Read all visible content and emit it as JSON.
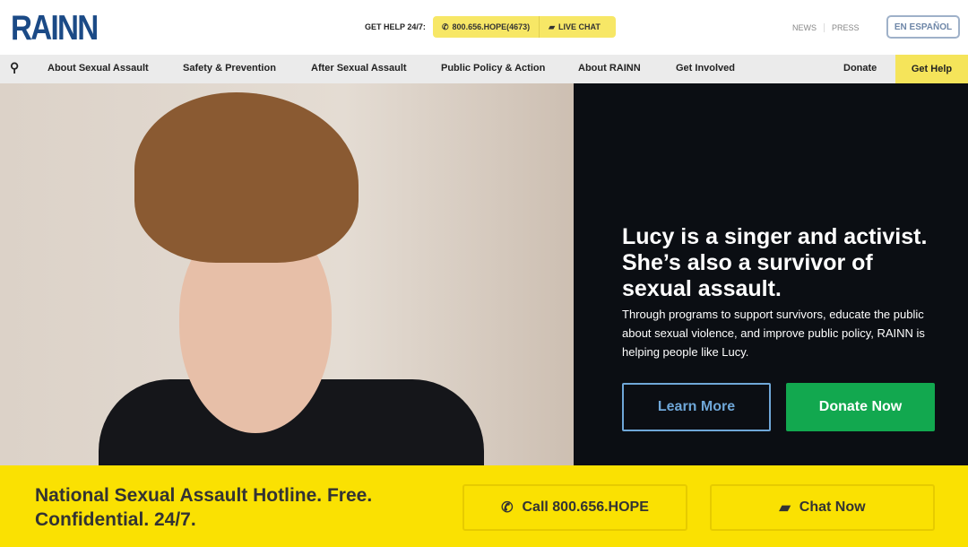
{
  "header": {
    "logo": "RAINN",
    "get_help": "GET HELP 24/7:",
    "phone": "800.656.HOPE(4673)",
    "live_chat": "LIVE CHAT",
    "news": "NEWS",
    "press": "PRESS",
    "espanol": "EN ESPAÑOL"
  },
  "nav": {
    "items": [
      "About Sexual Assault",
      "Safety & Prevention",
      "After Sexual Assault",
      "Public Policy & Action",
      "About RAINN",
      "Get Involved"
    ],
    "donate": "Donate",
    "get_help": "Get Help"
  },
  "hero": {
    "headline": "Lucy is a singer and activist. She’s also a survivor of sexual assault.",
    "body": "Through programs to support survivors, educate the public about sexual violence, and improve public policy, RAINN is helping people like Lucy.",
    "learn_more": "Learn More",
    "donate_now": "Donate Now"
  },
  "hotline": {
    "text": "National Sexual Assault Hotline. Free. Confidential. 24/7.",
    "call": "Call 800.656.HOPE",
    "chat": "Chat Now"
  }
}
